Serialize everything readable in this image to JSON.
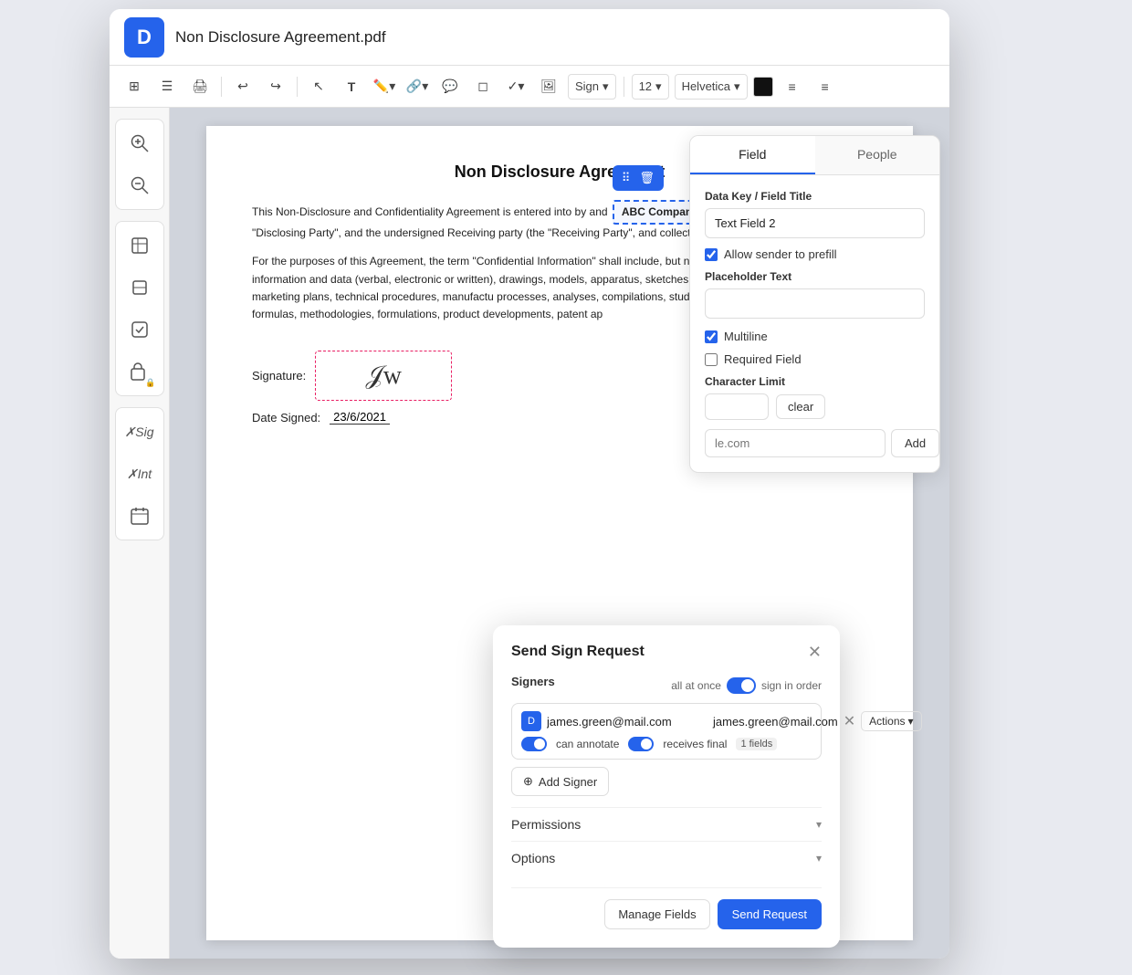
{
  "app": {
    "logo": "D",
    "title": "Non Disclosure Agreement.pdf"
  },
  "toolbar": {
    "font_size": "12",
    "font_family": "Helvetica",
    "sign_label": "Sign",
    "sign_chevron": "▾"
  },
  "sidebar": {
    "groups": [
      {
        "icons": [
          "zoom_in",
          "zoom_out"
        ]
      },
      {
        "icons": [
          "crop",
          "resize",
          "checkbox",
          "doc_lock"
        ]
      },
      {
        "icons": [
          "signature",
          "initials",
          "calendar"
        ]
      }
    ]
  },
  "document": {
    "title": "Non Disclosure Agreement",
    "paragraph1": "This Non-Disclosure and Confidentiality Agreement is entered into by and",
    "company_field": "ABC Company",
    "paragraph1b": ", hereinafter known as the \"Disclosing Party\", and the undersigned Receiving party (the \"Receiving Party\", and collectively both known as \"Parties\".",
    "paragraph2": "For the purposes of this Agreement, the term \"Confidential Information\" shall include, but not be limited to, documents, records, information and data (verbal, electronic or written), drawings, models, apparatus, sketches, desi schedules, product plans, marketing plans, technical procedures, manufactu processes, analyses, compilations, studies, software, prototypes, samples formulas, methodologies, formulations, product developments, patent ap",
    "signature_label": "Signature:",
    "date_label": "Date Signed:",
    "date_value": "23/6/2021"
  },
  "field_panel": {
    "tab_field": "Field",
    "tab_people": "People",
    "data_key_label": "Data Key / Field Title",
    "data_key_value": "Text Field 2",
    "allow_prefill_label": "Allow sender to prefill",
    "placeholder_label": "Placeholder Text",
    "placeholder_value": "",
    "multiline_label": "Multiline",
    "required_label": "Required Field",
    "char_limit_label": "Character Limit",
    "char_limit_value": "",
    "clear_label": "clear",
    "people_email_placeholder": "le.com",
    "people_add_label": "Add"
  },
  "modal": {
    "title": "Send Sign Request",
    "signers_label": "Signers",
    "all_at_once_label": "all at once",
    "sign_in_order_label": "sign in order",
    "signer_email": "james.green@mail.com",
    "can_annotate_label": "can annotate",
    "receives_final_label": "receives final",
    "fields_label": "fields",
    "fields_count": "1",
    "actions_label": "Actions",
    "add_signer_label": "Add Signer",
    "permissions_label": "Permissions",
    "options_label": "Options",
    "manage_fields_label": "Manage Fields",
    "send_request_label": "Send Request"
  },
  "field_toolbar": {
    "grid_icon": "⠿",
    "delete_icon": "🗑"
  }
}
